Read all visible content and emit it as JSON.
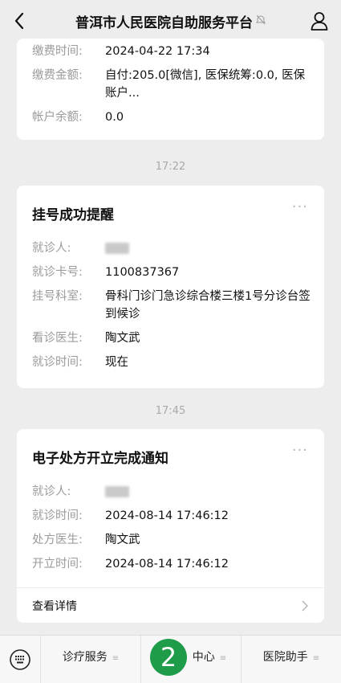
{
  "header": {
    "back_icon": "chevron-left-icon",
    "title": "普洱市人民医院自助服务平台",
    "mute_icon": "bell-muted-icon",
    "user_icon": "user-icon"
  },
  "card1": {
    "rows": [
      {
        "label": "缴费时间:",
        "value": "2024-04-22 17:34"
      },
      {
        "label": "缴费金额:",
        "value": "自付:205.0[微信], 医保统筹:0.0, 医保账户..."
      },
      {
        "label": "帐户余额:",
        "value": "0.0"
      }
    ]
  },
  "time1": "17:22",
  "card2": {
    "title": "挂号成功提醒",
    "rows": [
      {
        "label": "就诊人:",
        "value": ""
      },
      {
        "label": "就诊卡号:",
        "value": "1100837367"
      },
      {
        "label": "挂号科室:",
        "value": "骨科门诊门急诊综合楼三楼1号分诊台签到候诊"
      },
      {
        "label": "看诊医生:",
        "value": "陶文武"
      },
      {
        "label": "就诊时间:",
        "value": "现在"
      }
    ]
  },
  "time2": "17:45",
  "card3": {
    "title": "电子处方开立完成通知",
    "rows": [
      {
        "label": "就诊人:",
        "value": ""
      },
      {
        "label": "就诊时间:",
        "value": "2024-08-14 17:46:12"
      },
      {
        "label": "处方医生:",
        "value": "陶文武"
      },
      {
        "label": "开立时间:",
        "value": "2024-08-14 17:46:12"
      }
    ],
    "detail_label": "查看详情"
  },
  "footer": {
    "keyboard_icon": "keyboard-icon",
    "menus": [
      "诊疗服务",
      "中心",
      "医院助手"
    ],
    "badge": "2"
  },
  "colors": {
    "accent": "#1f9c4a",
    "background": "#ededed"
  }
}
